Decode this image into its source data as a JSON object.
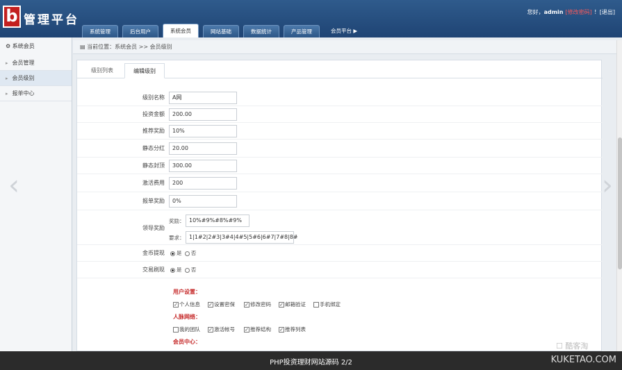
{
  "header": {
    "logo_letter": "b",
    "logo_text": "管理平台",
    "user": {
      "greeting": "您好，",
      "name": "admin",
      "pwd": "[修改密码]",
      "sep": "！",
      "logout": "[退出]"
    },
    "tabs": [
      "系统管理",
      "后台用户",
      "系统会员",
      "网站基础",
      "数据统计",
      "产品管理",
      "会员平台 ▶"
    ]
  },
  "sidebar": {
    "title": "系统会员",
    "items": [
      "会员管理",
      "会员级别",
      "报单中心"
    ]
  },
  "breadcrumb": "当前位置：系统会员 >> 会员级别",
  "subtabs": [
    "级别列表",
    "编辑级别"
  ],
  "form": {
    "fields": [
      {
        "label": "级别名称",
        "value": "A网"
      },
      {
        "label": "投资金额",
        "value": "200.00"
      },
      {
        "label": "推荐奖励",
        "value": "10%"
      },
      {
        "label": "静态分红",
        "value": "20.00"
      },
      {
        "label": "静态封顶",
        "value": "300.00"
      },
      {
        "label": "激活费用",
        "value": "200"
      },
      {
        "label": "报单奖励",
        "value": "0%"
      }
    ],
    "leader": {
      "label": "领导奖励",
      "reward_label": "奖励：",
      "reward_value": "10%#9%#8%#9%",
      "req_label": "要求：",
      "req_value": "1|1#2|2#3|3#4|4#5|5#6|6#7|7#8|8#"
    },
    "gold": {
      "label": "金币提现",
      "yes": "是",
      "no": "否"
    },
    "trade": {
      "label": "交易刷现",
      "yes": "是",
      "no": "否"
    },
    "perm_sections": [
      {
        "title": "用户设置：",
        "items": [
          {
            "t": "个人信息",
            "c": true
          },
          {
            "t": "设置密保",
            "c": true
          },
          {
            "t": "修改密码",
            "c": true
          },
          {
            "t": "邮箱验证",
            "c": true
          },
          {
            "t": "手机绑定",
            "c": false
          }
        ]
      },
      {
        "title": "人脉网络：",
        "items": [
          {
            "t": "我的团队",
            "c": false
          },
          {
            "t": "激活帐号",
            "c": true
          },
          {
            "t": "推荐结构",
            "c": true
          },
          {
            "t": "推荐列表",
            "c": true
          }
        ]
      },
      {
        "title": "会员中心：",
        "items": [
          {
            "t": "",
            "c": true
          },
          {
            "t": "",
            "c": true
          },
          {
            "t": "",
            "c": true
          }
        ]
      }
    ]
  },
  "footer": {
    "caption": "PHP投资理财网站源码    2/2",
    "site": "KUKETAO.COM",
    "watermark": "☐ 酷客淘"
  }
}
